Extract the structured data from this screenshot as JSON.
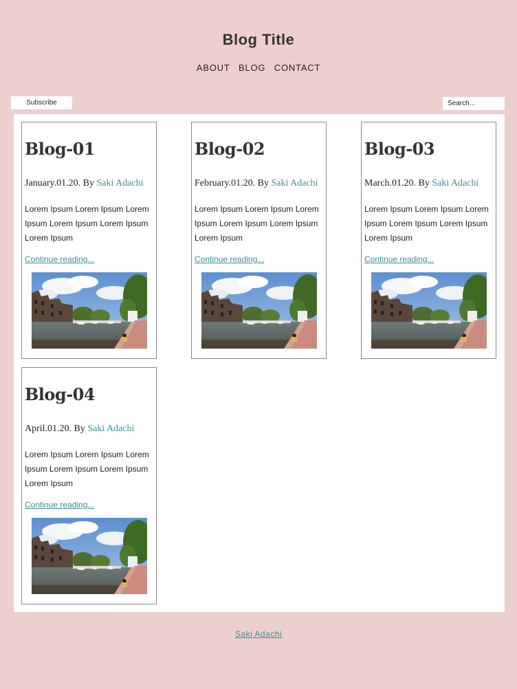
{
  "header": {
    "title": "Blog Title",
    "nav": [
      {
        "label": "ABOUT"
      },
      {
        "label": "BLOG"
      },
      {
        "label": "CONTACT"
      }
    ]
  },
  "toolbar": {
    "subscribe_label": "Subscribe",
    "search_placeholder": "Search..."
  },
  "posts": [
    {
      "title": "Blog-01",
      "date": "January.01.20. By ",
      "author": "Saki Adachi",
      "excerpt": "Lorem Ipsum Lorem Ipsum Lorem Ipsum Lorem Ipsum Lorem Ipsum Lorem Ipsum",
      "more": "Continue reading...",
      "image": "canal-photo"
    },
    {
      "title": "Blog-02",
      "date": "February.01.20. By ",
      "author": "Saki Adachi",
      "excerpt": "Lorem Ipsum Lorem Ipsum Lorem Ipsum Lorem Ipsum Lorem Ipsum Lorem Ipsum",
      "more": "Continue reading...",
      "image": "canal-photo"
    },
    {
      "title": "Blog-03",
      "date": "March.01.20. By ",
      "author": "Saki Adachi",
      "excerpt": "Lorem Ipsum Lorem Ipsum Lorem Ipsum Lorem Ipsum Lorem Ipsum Lorem Ipsum",
      "more": "Continue reading...",
      "image": "canal-photo"
    },
    {
      "title": "Blog-04",
      "date": "April.01.20. By ",
      "author": "Saki Adachi",
      "excerpt": "Lorem Ipsum Lorem Ipsum Lorem Ipsum Lorem Ipsum Lorem Ipsum Lorem Ipsum",
      "more": "Continue reading...",
      "image": "canal-photo"
    }
  ],
  "footer": {
    "author_link": "Saki Adachi"
  },
  "colors": {
    "background": "#ecd0cd",
    "link": "#3d8d93",
    "card_border": "#888888"
  }
}
